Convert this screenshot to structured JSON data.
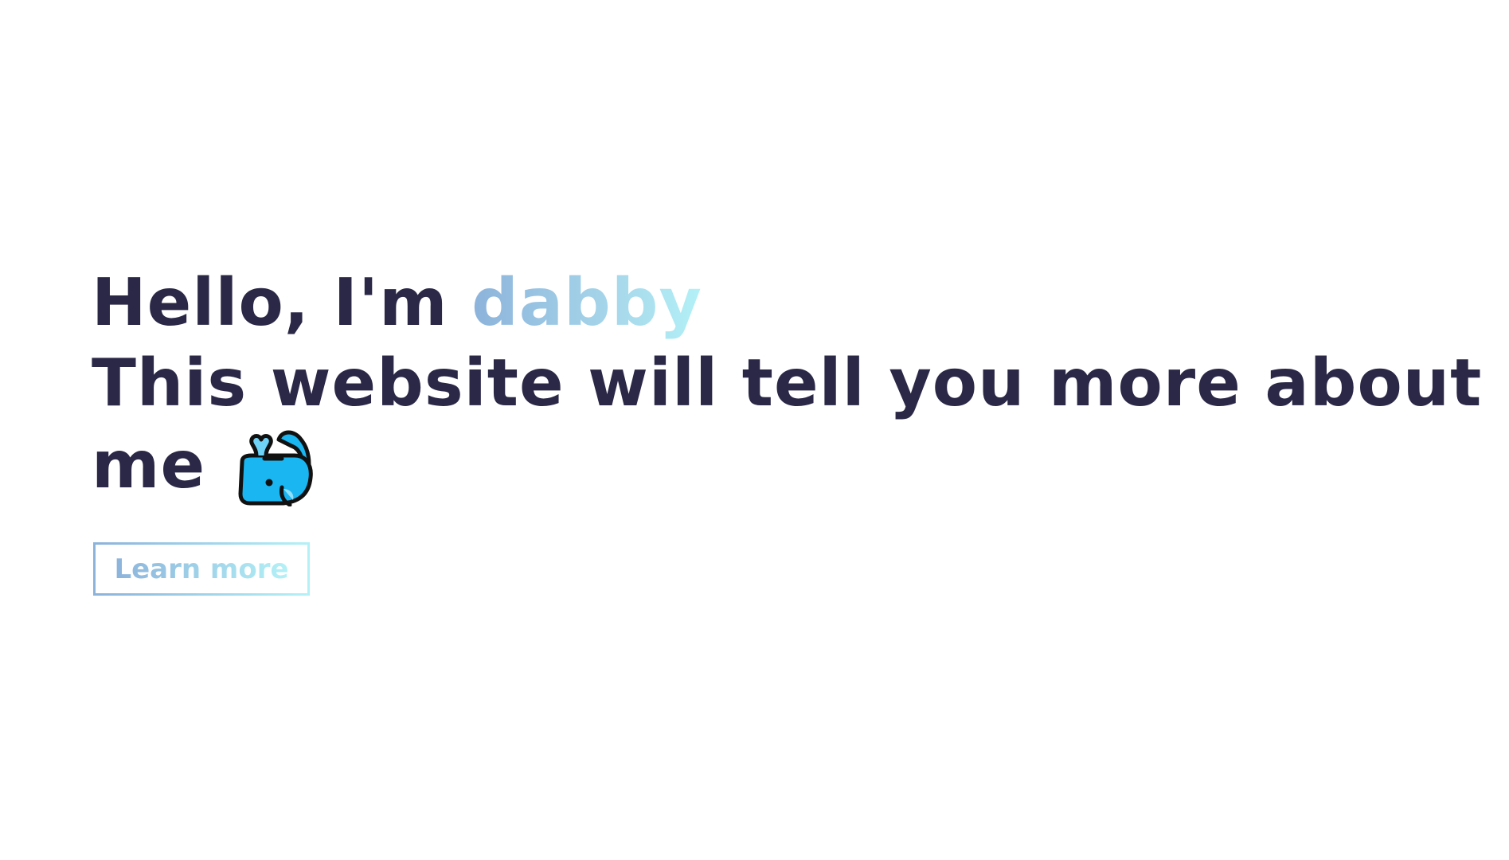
{
  "hero": {
    "greeting_prefix": "Hello, I'm ",
    "name": "dabby",
    "tagline_line1": "This website will tell you more about",
    "tagline_line2": "me",
    "emoji_icon": "whale-icon",
    "cta_label": "Learn more"
  },
  "colors": {
    "heading": "#2a2846",
    "gradient_start": "#8cb3db",
    "gradient_end": "#b3f1f7",
    "whale_body": "#19b6f1",
    "background": "#ffffff"
  }
}
